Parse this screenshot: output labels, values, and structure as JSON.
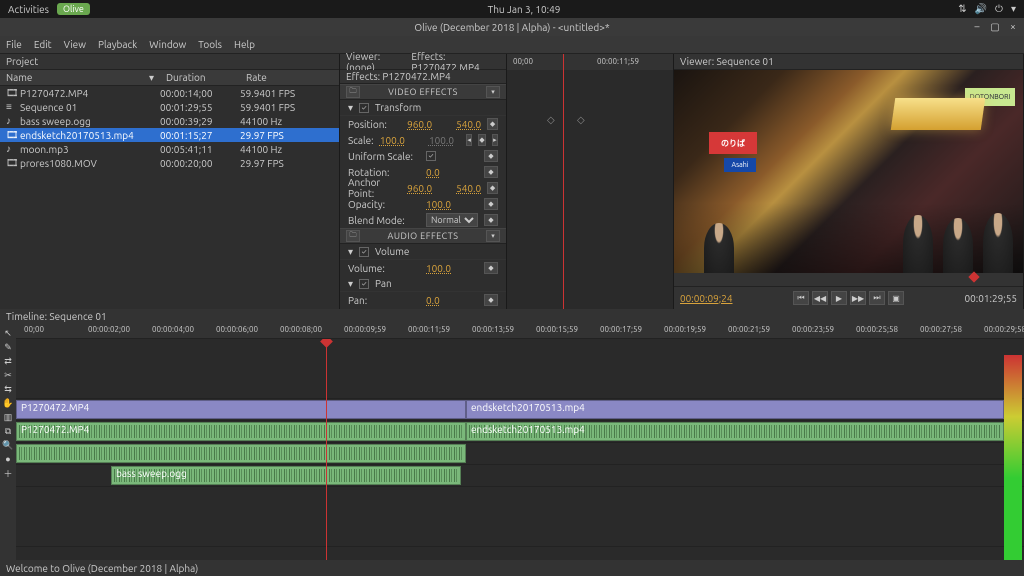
{
  "topbar": {
    "activities": "Activities",
    "app": "Olive",
    "clock": "Thu Jan  3, 10:49"
  },
  "window": {
    "title": "Olive (December 2018 | Alpha) - <untitled>*"
  },
  "menu": [
    "File",
    "Edit",
    "View",
    "Playback",
    "Window",
    "Tools",
    "Help"
  ],
  "project": {
    "title": "Project",
    "cols": {
      "name": "Name",
      "duration": "Duration",
      "rate": "Rate"
    },
    "rows": [
      {
        "icon": "🎞",
        "name": "P1270472.MP4",
        "dur": "00:00:14;00",
        "rate": "59.9401 FPS",
        "sel": false
      },
      {
        "icon": "≡",
        "name": "Sequence 01",
        "dur": "00:01:29;55",
        "rate": "59.9401 FPS",
        "sel": false
      },
      {
        "icon": "♪",
        "name": "bass sweep.ogg",
        "dur": "00:00:39;29",
        "rate": "44100 Hz",
        "sel": false
      },
      {
        "icon": "🎞",
        "name": "endsketch20170513.mp4",
        "dur": "00:01:15;27",
        "rate": "29.97 FPS",
        "sel": true
      },
      {
        "icon": "♪",
        "name": "moon.mp3",
        "dur": "00:05:41;11",
        "rate": "44100 Hz",
        "sel": false
      },
      {
        "icon": "🎞",
        "name": "prores1080.MOV",
        "dur": "00:00:20;00",
        "rate": "29.97 FPS",
        "sel": false
      }
    ]
  },
  "effects": {
    "viewer_label": "Viewer: (none)",
    "tab": "Effects: P1270472.MP4",
    "path": "Effects: P1270472.MP4",
    "video_title": "VIDEO EFFECTS",
    "transform": "Transform",
    "position": {
      "lbl": "Position:",
      "x": "960.0",
      "y": "540.0"
    },
    "scale": {
      "lbl": "Scale:",
      "x": "100.0",
      "y": "100.0"
    },
    "uniform": {
      "lbl": "Uniform Scale:"
    },
    "rotation": {
      "lbl": "Rotation:",
      "v": "0.0"
    },
    "anchor": {
      "lbl": "Anchor Point:",
      "x": "960.0",
      "y": "540.0"
    },
    "opacity": {
      "lbl": "Opacity:",
      "v": "100.0"
    },
    "blend": {
      "lbl": "Blend Mode:",
      "v": "Normal"
    },
    "audio_title": "AUDIO EFFECTS",
    "volume_sec": "Volume",
    "volume": {
      "lbl": "Volume:",
      "v": "100.0"
    },
    "pan_sec": "Pan",
    "pan": {
      "lbl": "Pan:",
      "v": "0.0"
    },
    "ruler": {
      "t0": "00;00",
      "t1": "00:00:11;59"
    }
  },
  "viewer": {
    "title": "Viewer: Sequence 01",
    "sign_noriba": "のりば",
    "sign_asahi": "Asahi",
    "sign_dot": "DOTONBORI",
    "tc_left": "00:00:09;24",
    "tc_right": "00:01:29;55"
  },
  "timeline": {
    "title": "Timeline: Sequence 01",
    "marks": [
      "00;00",
      "00:00:02;00",
      "00:00:04;00",
      "00:00:06;00",
      "00:00:08;00",
      "00:00:09;59",
      "00:00:11;59",
      "00:00:13;59",
      "00:00:15;59",
      "00:00:17;59",
      "00:00:19;59",
      "00:00:21;59",
      "00:00:23;59",
      "00:00:25;58",
      "00:00:27;58",
      "00:00:29;58"
    ],
    "clips": {
      "v1a": "P1270472.MP4",
      "v1b": "endsketch20170513.mp4",
      "v2a": "P1270472.MP4",
      "v2b": "endsketch20170513.mp4",
      "bass": "bass sweep.ogg"
    }
  },
  "status": "Welcome to Olive (December 2018 | Alpha)"
}
